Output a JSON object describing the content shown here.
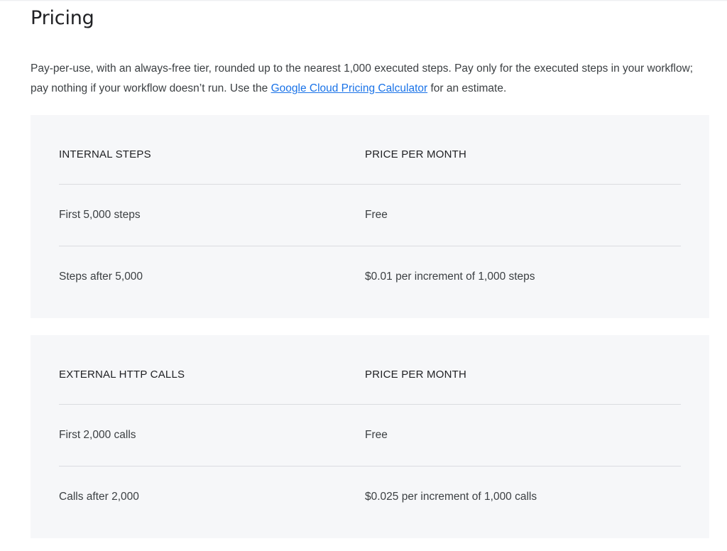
{
  "title": "Pricing",
  "intro": {
    "text_before": "Pay-per-use, with an always-free tier, rounded up to the nearest 1,000 executed steps. Pay only for the executed steps in your workflow; pay nothing if your workflow doesn’t run. Use the ",
    "link_text": "Google Cloud Pricing Calculator",
    "text_after": " for an estimate."
  },
  "tables": [
    {
      "headers": [
        "INTERNAL STEPS",
        "PRICE PER MONTH"
      ],
      "rows": [
        [
          "First 5,000 steps",
          "Free"
        ],
        [
          "Steps after 5,000",
          "$0.01 per increment of 1,000 steps"
        ]
      ]
    },
    {
      "headers": [
        "EXTERNAL HTTP CALLS",
        "PRICE PER MONTH"
      ],
      "rows": [
        [
          "First 2,000 calls",
          "Free"
        ],
        [
          "Calls after 2,000",
          "$0.025 per increment of 1,000 calls"
        ]
      ]
    }
  ],
  "colors": {
    "link": "#1a73e8",
    "table_background": "#f6f7f9",
    "divider": "#dadce0"
  }
}
